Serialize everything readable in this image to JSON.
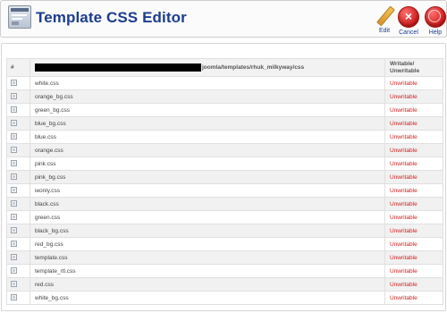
{
  "header": {
    "title": "Template CSS Editor",
    "toolbar": {
      "edit_label": "Edit",
      "cancel_label": "Cancel",
      "help_label": "Help"
    }
  },
  "table": {
    "col_num": "#",
    "path_suffix": "joomla/templates/rhuk_milkyway/css",
    "col_writable": "Writable/\nUnwritable",
    "rows": [
      {
        "name": "white.css",
        "status": "Unwritable"
      },
      {
        "name": "orange_bg.css",
        "status": "Unwritable"
      },
      {
        "name": "green_bg.css",
        "status": "Unwritable"
      },
      {
        "name": "blue_bg.css",
        "status": "Unwritable"
      },
      {
        "name": "blue.css",
        "status": "Unwritable"
      },
      {
        "name": "orange.css",
        "status": "Unwritable"
      },
      {
        "name": "pink.css",
        "status": "Unwritable"
      },
      {
        "name": "pink_bg.css",
        "status": "Unwritable"
      },
      {
        "name": "ieonly.css",
        "status": "Unwritable"
      },
      {
        "name": "black.css",
        "status": "Unwritable"
      },
      {
        "name": "green.css",
        "status": "Unwritable"
      },
      {
        "name": "black_bg.css",
        "status": "Unwritable"
      },
      {
        "name": "red_bg.css",
        "status": "Unwritable"
      },
      {
        "name": "template.css",
        "status": "Unwritable"
      },
      {
        "name": "template_rtl.css",
        "status": "Unwritable"
      },
      {
        "name": "red.css",
        "status": "Unwritable"
      },
      {
        "name": "white_bg.css",
        "status": "Unwritable"
      }
    ]
  },
  "colors": {
    "title": "#1b3d8f",
    "unwritable": "#d21f1f",
    "row_alt": "#f1f1f1"
  },
  "icons": [
    "template-icon",
    "edit-icon",
    "cancel-icon",
    "help-icon",
    "radio-icon"
  ]
}
